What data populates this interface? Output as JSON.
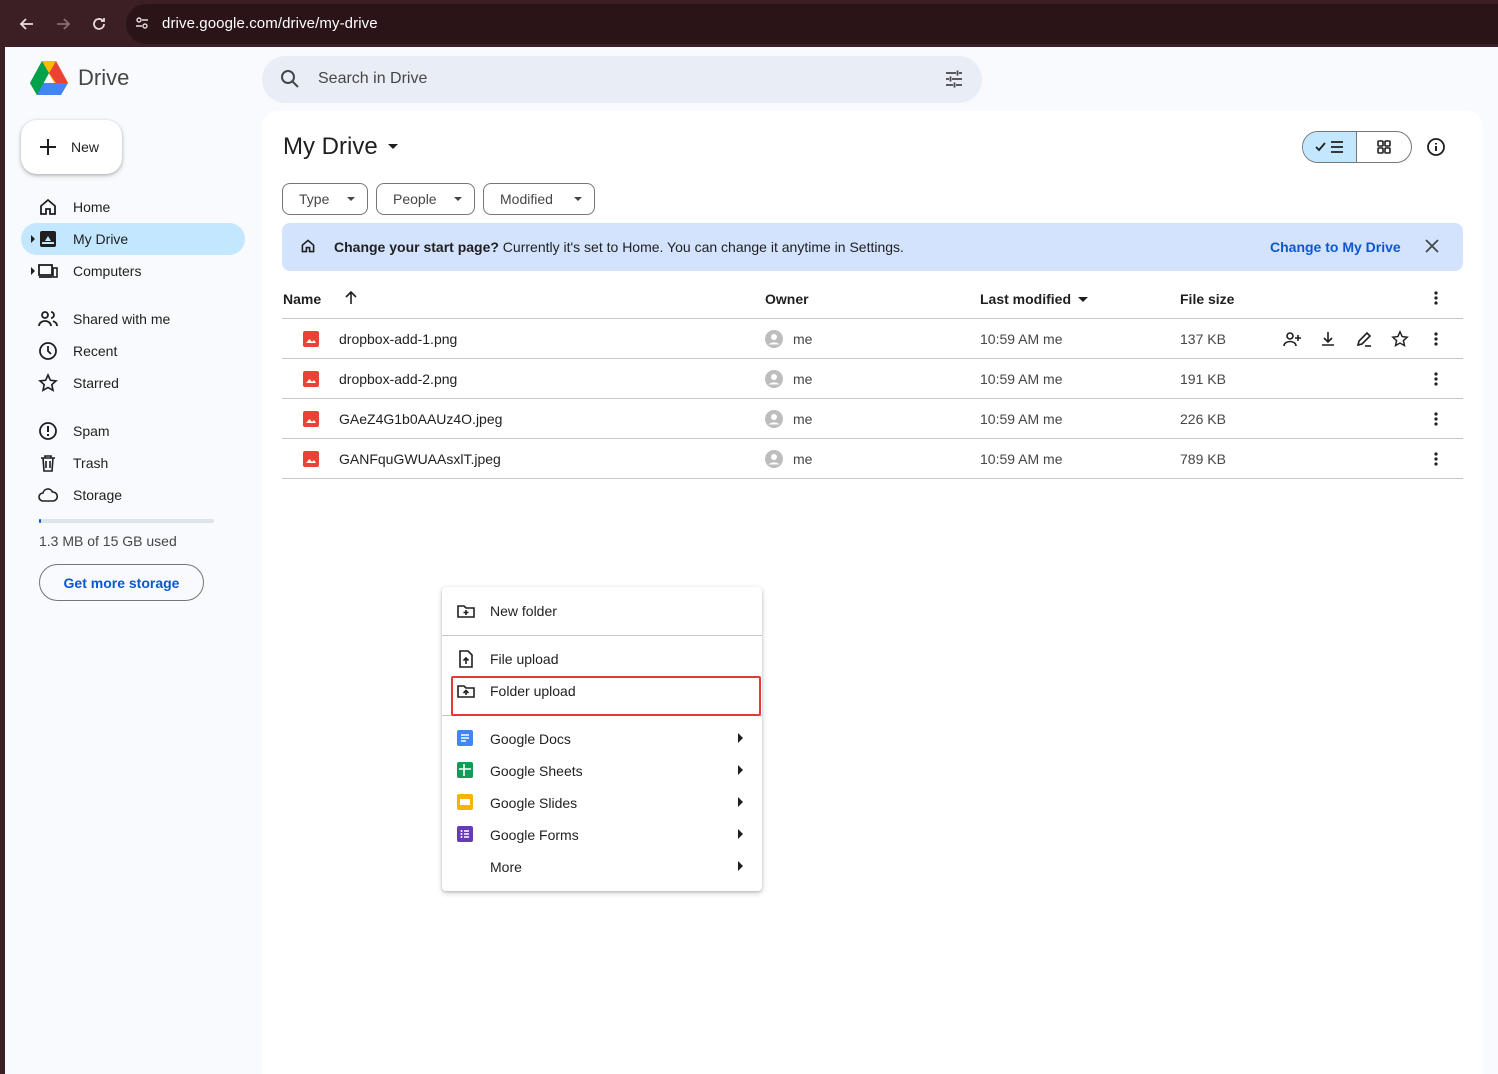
{
  "browser": {
    "url": "drive.google.com/drive/my-drive"
  },
  "app": {
    "name": "Drive"
  },
  "search": {
    "placeholder": "Search in Drive"
  },
  "new_button": {
    "label": "New"
  },
  "sidebar": {
    "items": [
      {
        "label": "Home",
        "icon": "home-icon"
      },
      {
        "label": "My Drive",
        "icon": "my-drive-icon",
        "active": true
      },
      {
        "label": "Computers",
        "icon": "computers-icon"
      },
      {
        "label": "Shared with me",
        "icon": "people-icon"
      },
      {
        "label": "Recent",
        "icon": "clock-icon"
      },
      {
        "label": "Starred",
        "icon": "star-icon"
      },
      {
        "label": "Spam",
        "icon": "spam-icon"
      },
      {
        "label": "Trash",
        "icon": "trash-icon"
      },
      {
        "label": "Storage",
        "icon": "cloud-icon"
      }
    ],
    "storage_text": "1.3 MB of 15 GB used",
    "storage_used_fraction": 0.0001,
    "get_storage_label": "Get more storage"
  },
  "main": {
    "title": "My Drive",
    "filters": [
      "Type",
      "People",
      "Modified"
    ],
    "banner": {
      "bold": "Change your start page?",
      "text": " Currently it's set to Home. You can change it anytime in Settings.",
      "action": "Change to My Drive"
    },
    "columns": {
      "name": "Name",
      "owner": "Owner",
      "modified": "Last modified",
      "size": "File size"
    },
    "files": [
      {
        "name": "dropbox-add-1.png",
        "owner": "me",
        "modified": "10:59 AM  me",
        "size": "137 KB"
      },
      {
        "name": "dropbox-add-2.png",
        "owner": "me",
        "modified": "10:59 AM  me",
        "size": "191 KB"
      },
      {
        "name": "GAeZ4G1b0AAUz4O.jpeg",
        "owner": "me",
        "modified": "10:59 AM  me",
        "size": "226 KB"
      },
      {
        "name": "GANFquGWUAAsxlT.jpeg",
        "owner": "me",
        "modified": "10:59 AM  me",
        "size": "789 KB"
      }
    ]
  },
  "menu": {
    "items": [
      {
        "label": "New folder"
      },
      {
        "label": "File upload"
      },
      {
        "label": "Folder upload"
      },
      {
        "label": "Google Docs"
      },
      {
        "label": "Google Sheets"
      },
      {
        "label": "Google Slides"
      },
      {
        "label": "Google Forms"
      },
      {
        "label": "More"
      }
    ]
  },
  "colors": {
    "accent": "#0b57d0",
    "active_bg": "#c2e7ff",
    "banner_bg": "#d3e3fd",
    "highlight": "#e53935"
  }
}
